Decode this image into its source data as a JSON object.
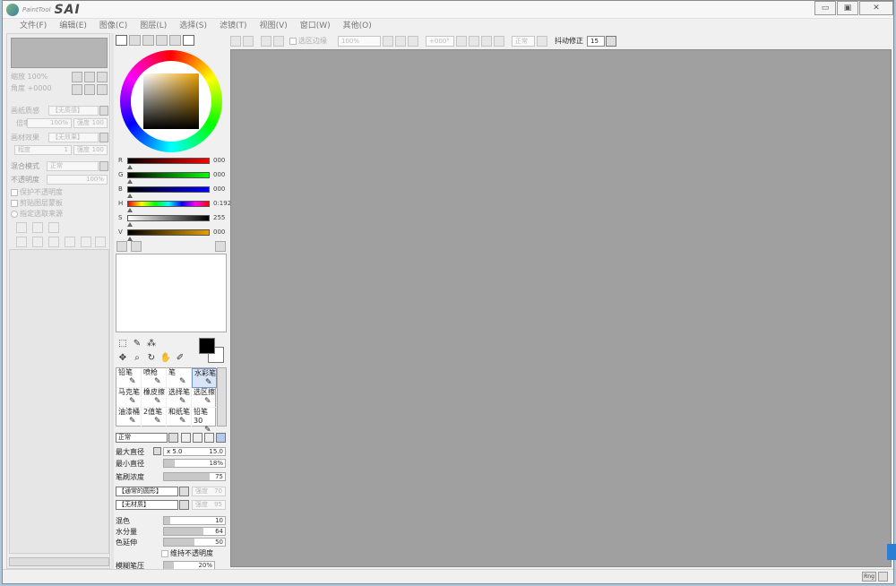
{
  "app": {
    "logo_small": "PaintTool",
    "logo_big": "SAI"
  },
  "window_controls": {
    "minimize": "▭",
    "restore": "▣",
    "close": "✕"
  },
  "menu": [
    "文件(F)",
    "编辑(E)",
    "图像(C)",
    "图层(L)",
    "选择(S)",
    "滤镜(T)",
    "视图(V)",
    "窗口(W)",
    "其他(O)"
  ],
  "left_panel": {
    "zoom_label": "缩放 100%",
    "angle_label": "角度 +0000",
    "paper_texture_label": "画纸质感",
    "paper_texture_value": "【无质感】",
    "scale_label": "倍率",
    "scale_value": "100%",
    "strength_label": "强度",
    "strength_value": "100",
    "paper_effect_label": "画材效果",
    "paper_effect_value": "【无效果】",
    "degree_label": "程度",
    "degree_value": "1",
    "strength2_label": "强度",
    "strength2_value": "100",
    "blend_label": "混合模式",
    "blend_value": "正常",
    "opacity_label": "不透明度",
    "opacity_value": "100%",
    "protect_opacity": "保护不透明度",
    "clip_layer": "剪贴图层蒙板",
    "select_source": "指定选取来源"
  },
  "color": {
    "sliders": [
      {
        "label": "R",
        "value": "000",
        "gradient": "linear-gradient(to right,#000,#ff0000)"
      },
      {
        "label": "G",
        "value": "000",
        "gradient": "linear-gradient(to right,#000,#00ff00)"
      },
      {
        "label": "B",
        "value": "000",
        "gradient": "linear-gradient(to right,#000,#0000ff)"
      },
      {
        "label": "H",
        "value": "0:192",
        "gradient": "linear-gradient(to right,#f00,#ff0,#0f0,#0ff,#00f,#f0f,#f00)"
      },
      {
        "label": "S",
        "value": "255",
        "gradient": "linear-gradient(to right,#fff,#000)"
      },
      {
        "label": "V",
        "value": "000",
        "gradient": "linear-gradient(to right,#000,#e8a000)"
      }
    ]
  },
  "brushes": [
    {
      "name": "铅笔"
    },
    {
      "name": "喷枪"
    },
    {
      "name": "笔"
    },
    {
      "name": "水彩笔",
      "selected": true
    },
    {
      "name": "马克笔"
    },
    {
      "name": "橡皮擦"
    },
    {
      "name": "选择笔"
    },
    {
      "name": "选区擦"
    },
    {
      "name": "油漆桶"
    },
    {
      "name": "2值笔"
    },
    {
      "name": "和纸笔"
    },
    {
      "name": "铅笔30"
    }
  ],
  "brush_props": {
    "mode": "正常",
    "max_diameter_label": "最大直径",
    "max_diameter_mult": "x 5.0",
    "max_diameter_value": "15.0",
    "min_diameter_label": "最小直径",
    "min_diameter_value": "18%",
    "min_diameter_fill": 18,
    "density_label": "笔刷浓度",
    "density_value": "75",
    "density_fill": 75,
    "shape_value": "【通常的圆形】",
    "shape_strength_label": "强度",
    "shape_strength_value": "70",
    "texture_value": "【无材质】",
    "texture_strength_label": "强度",
    "texture_strength_value": "95",
    "blend_label": "混色",
    "blend_value": "10",
    "blend_fill": 10,
    "water_label": "水分量",
    "water_value": "64",
    "water_fill": 64,
    "extend_label": "色延伸",
    "extend_value": "50",
    "extend_fill": 50,
    "keep_opacity": "维持不透明度",
    "blur_label": "模糊笔压",
    "blur_value": "20%",
    "blur_fill": 20
  },
  "canvas_toolbar": {
    "selection_edge": "选区边缘",
    "zoom": "100%",
    "angle": "+000°",
    "mode": "正常",
    "stabilizer_label": "抖动修正",
    "stabilizer_value": "15"
  },
  "status": {
    "mem": "Rng"
  }
}
